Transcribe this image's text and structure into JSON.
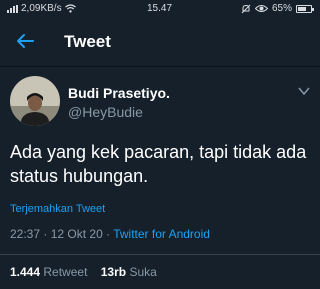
{
  "status_bar": {
    "network": "2,09KB/s",
    "time": "15.47",
    "battery": "65%",
    "battery_level": 0.65
  },
  "header": {
    "title": "Tweet",
    "back_icon": "arrow-left-icon"
  },
  "tweet": {
    "author_name": "Budi Prasetiyo.",
    "author_handle": "@HeyBudie",
    "text": "Ada yang kek pacaran, tapi tidak ada status hubungan.",
    "translate_label": "Terjemahkan Tweet",
    "time": "22:37",
    "date": "12 Okt 20",
    "source": "Twitter for Android",
    "meta_separator": "·",
    "retweet_count": "1.444",
    "retweet_label": "Retweet",
    "like_count": "13rb",
    "like_label": "Suka"
  },
  "colors": {
    "background": "#15202b",
    "accent": "#1da1f2",
    "secondary_text": "#8899a6"
  }
}
